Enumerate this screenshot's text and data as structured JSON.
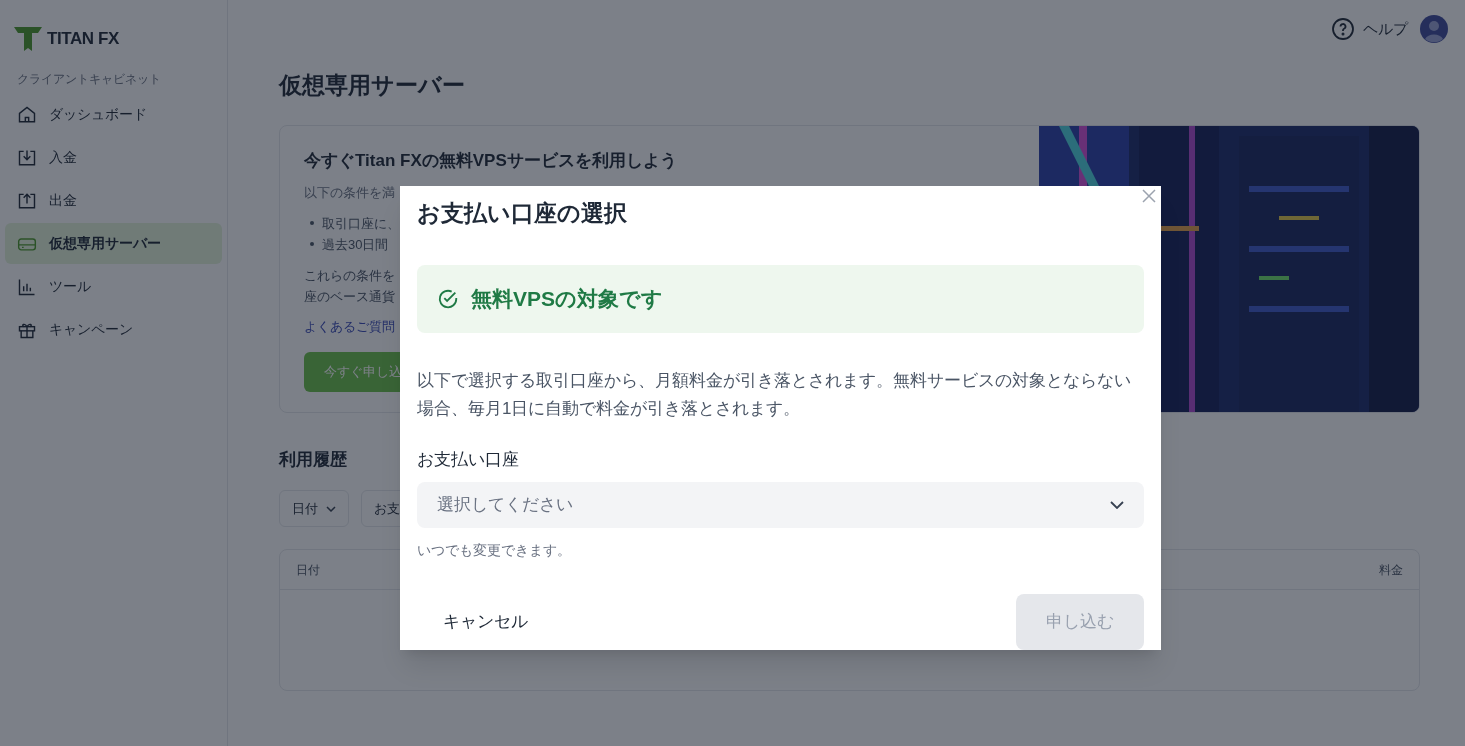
{
  "sidebar": {
    "logo": "TITAN FX",
    "section_label": "クライアントキャビネット",
    "items": [
      {
        "label": "ダッシュボード",
        "selected": false
      },
      {
        "label": "入金",
        "selected": false
      },
      {
        "label": "出金",
        "selected": false
      },
      {
        "label": "仮想専用サーバー",
        "selected": true
      },
      {
        "label": "ツール",
        "selected": false
      },
      {
        "label": "キャンペーン",
        "selected": false
      }
    ]
  },
  "header": {
    "help": "ヘルプ"
  },
  "page_title": "仮想専用サーバー",
  "promo": {
    "title": "今すぐTitan FXの無料VPSサービスを利用しよう",
    "intro": "以下の条件を満",
    "bullets": [
      "取引口座に、",
      "過去30日間"
    ],
    "text_lines": [
      "これらの条件を",
      "座のベース通貨"
    ],
    "link": "よくあるご質問",
    "button": "今すぐ申し込"
  },
  "history": {
    "title": "利用履歴",
    "filters": [
      "日付",
      "お支"
    ],
    "columns": [
      "日付",
      "料金"
    ]
  },
  "modal": {
    "title": "お支払い口座の選択",
    "status": {
      "text": "無料VPSの対象です",
      "eligible": true
    },
    "description": "以下で選択する取引口座から、月額料金が引き落とされます。無料サービスの対象とならない場合、毎月1日に自動で料金が引き落とされます。",
    "field": {
      "label": "お支払い口座",
      "placeholder": "選択してください"
    },
    "hint": "いつでも変更できます。",
    "cancel": "キャンセル",
    "submit": {
      "label": "申し込む",
      "disabled": true
    }
  }
}
